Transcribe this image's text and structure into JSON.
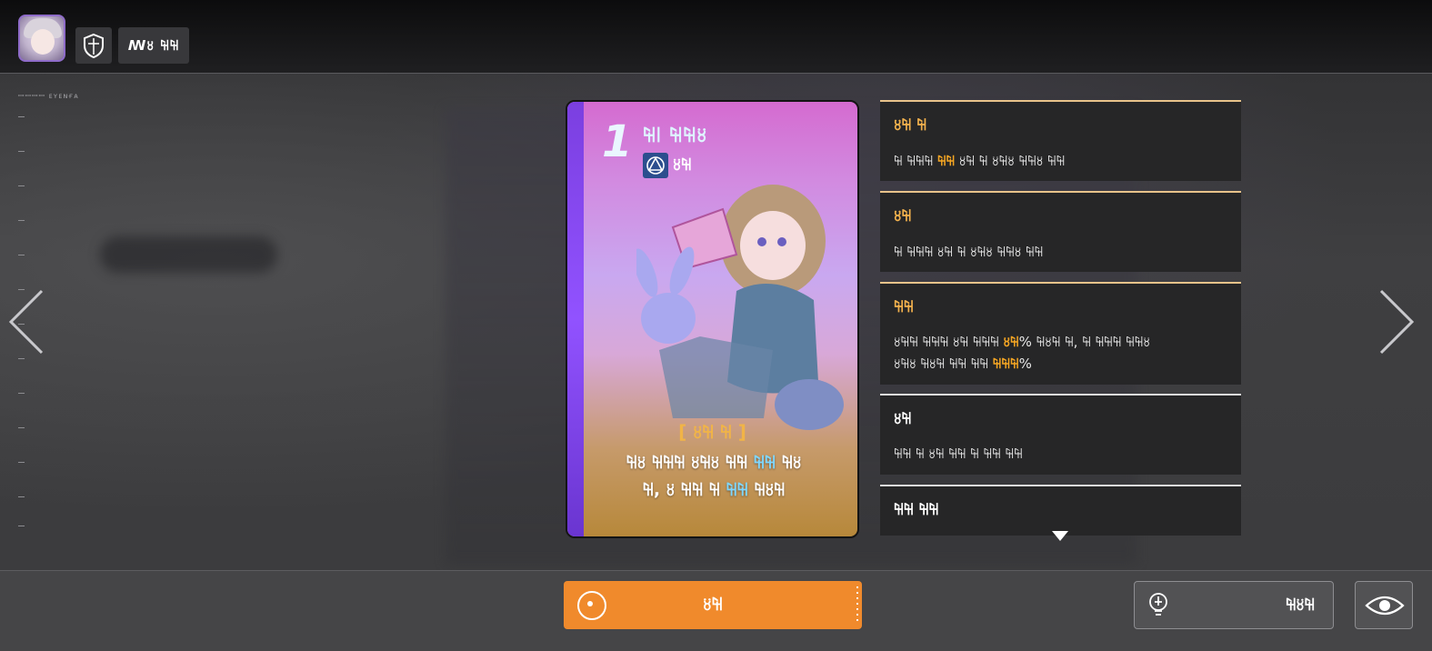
{
  "header": {
    "name_button_label": "ꟿ꘨ ꘤꘤",
    "tiny_label": "ꟷꟷꟷꟷ ᴇʏᴇɴғᴀ"
  },
  "card": {
    "cost": "1",
    "title": "꘤꘡ ꘤꘤꘨",
    "type_label": "꘨꘤",
    "quote_head": "[ ꘨꘤ ꘤ ]",
    "quote_line1": "꘤꘨ ꘤꘤꘤ ꘨꘤꘨ ꘤꘤",
    "quote_line1_hl": "꘤꘤",
    "quote_line1_tail": "꘤꘨",
    "quote_line2": "꘤, ꘨ ꘤꘤ ꘤",
    "quote_line2_hl": "꘤꘤",
    "quote_line2_tail": "꘤꘨꘤"
  },
  "panels": [
    {
      "title": "꘨꘤ ꘤",
      "body_a": "꘤ ꘤꘤꘤ ",
      "body_hl": "꘤꘤",
      "body_b": " ꘨꘤ ꘤ ꘨꘤꘨ ꘤꘤꘨ ꘤꘤"
    },
    {
      "title": "꘨꘤",
      "body": "꘤ ꘤꘤꘤ ꘨꘤ ꘤ ꘨꘤꘨ ꘤꘤꘨ ꘤꘤"
    },
    {
      "title": "꘤꘤",
      "body_a": "꘨꘤꘤ ꘤꘤꘤ ꘨꘤ ꘤꘤꘤ ",
      "pct1": "꘨꘤",
      "body_b": "% ꘤꘨꘤ ꘤, ꘤ ꘤꘤꘤ ꘤꘤꘨",
      "body_c": "꘨꘤꘨ ꘤꘨꘤ ꘤꘤ ꘤꘤ ",
      "pct2": "꘤꘤꘤",
      "body_d": "%"
    },
    {
      "title": "꘨꘤",
      "body": "꘤꘤ ꘤ ꘨꘤ ꘤꘤ ꘤ ꘤꘤ ꘤꘤"
    },
    {
      "title": "꘤꘤ ꘤꘤"
    }
  ],
  "actions": {
    "main_label": "꘨꘤",
    "hint_label": "꘤꘨꘤"
  },
  "colors": {
    "accent_orange": "#f08a2c",
    "highlight_gold": "#f5a623",
    "highlight_cyan": "#7fd7ff",
    "card_stripe": "#9152ff"
  },
  "icons": {
    "shield": "shield-icon",
    "left_arrow": "chevron-left-icon",
    "right_arrow": "chevron-right-icon",
    "target": "target-icon",
    "lightbulb": "lightbulb-icon",
    "eye": "eye-icon"
  }
}
